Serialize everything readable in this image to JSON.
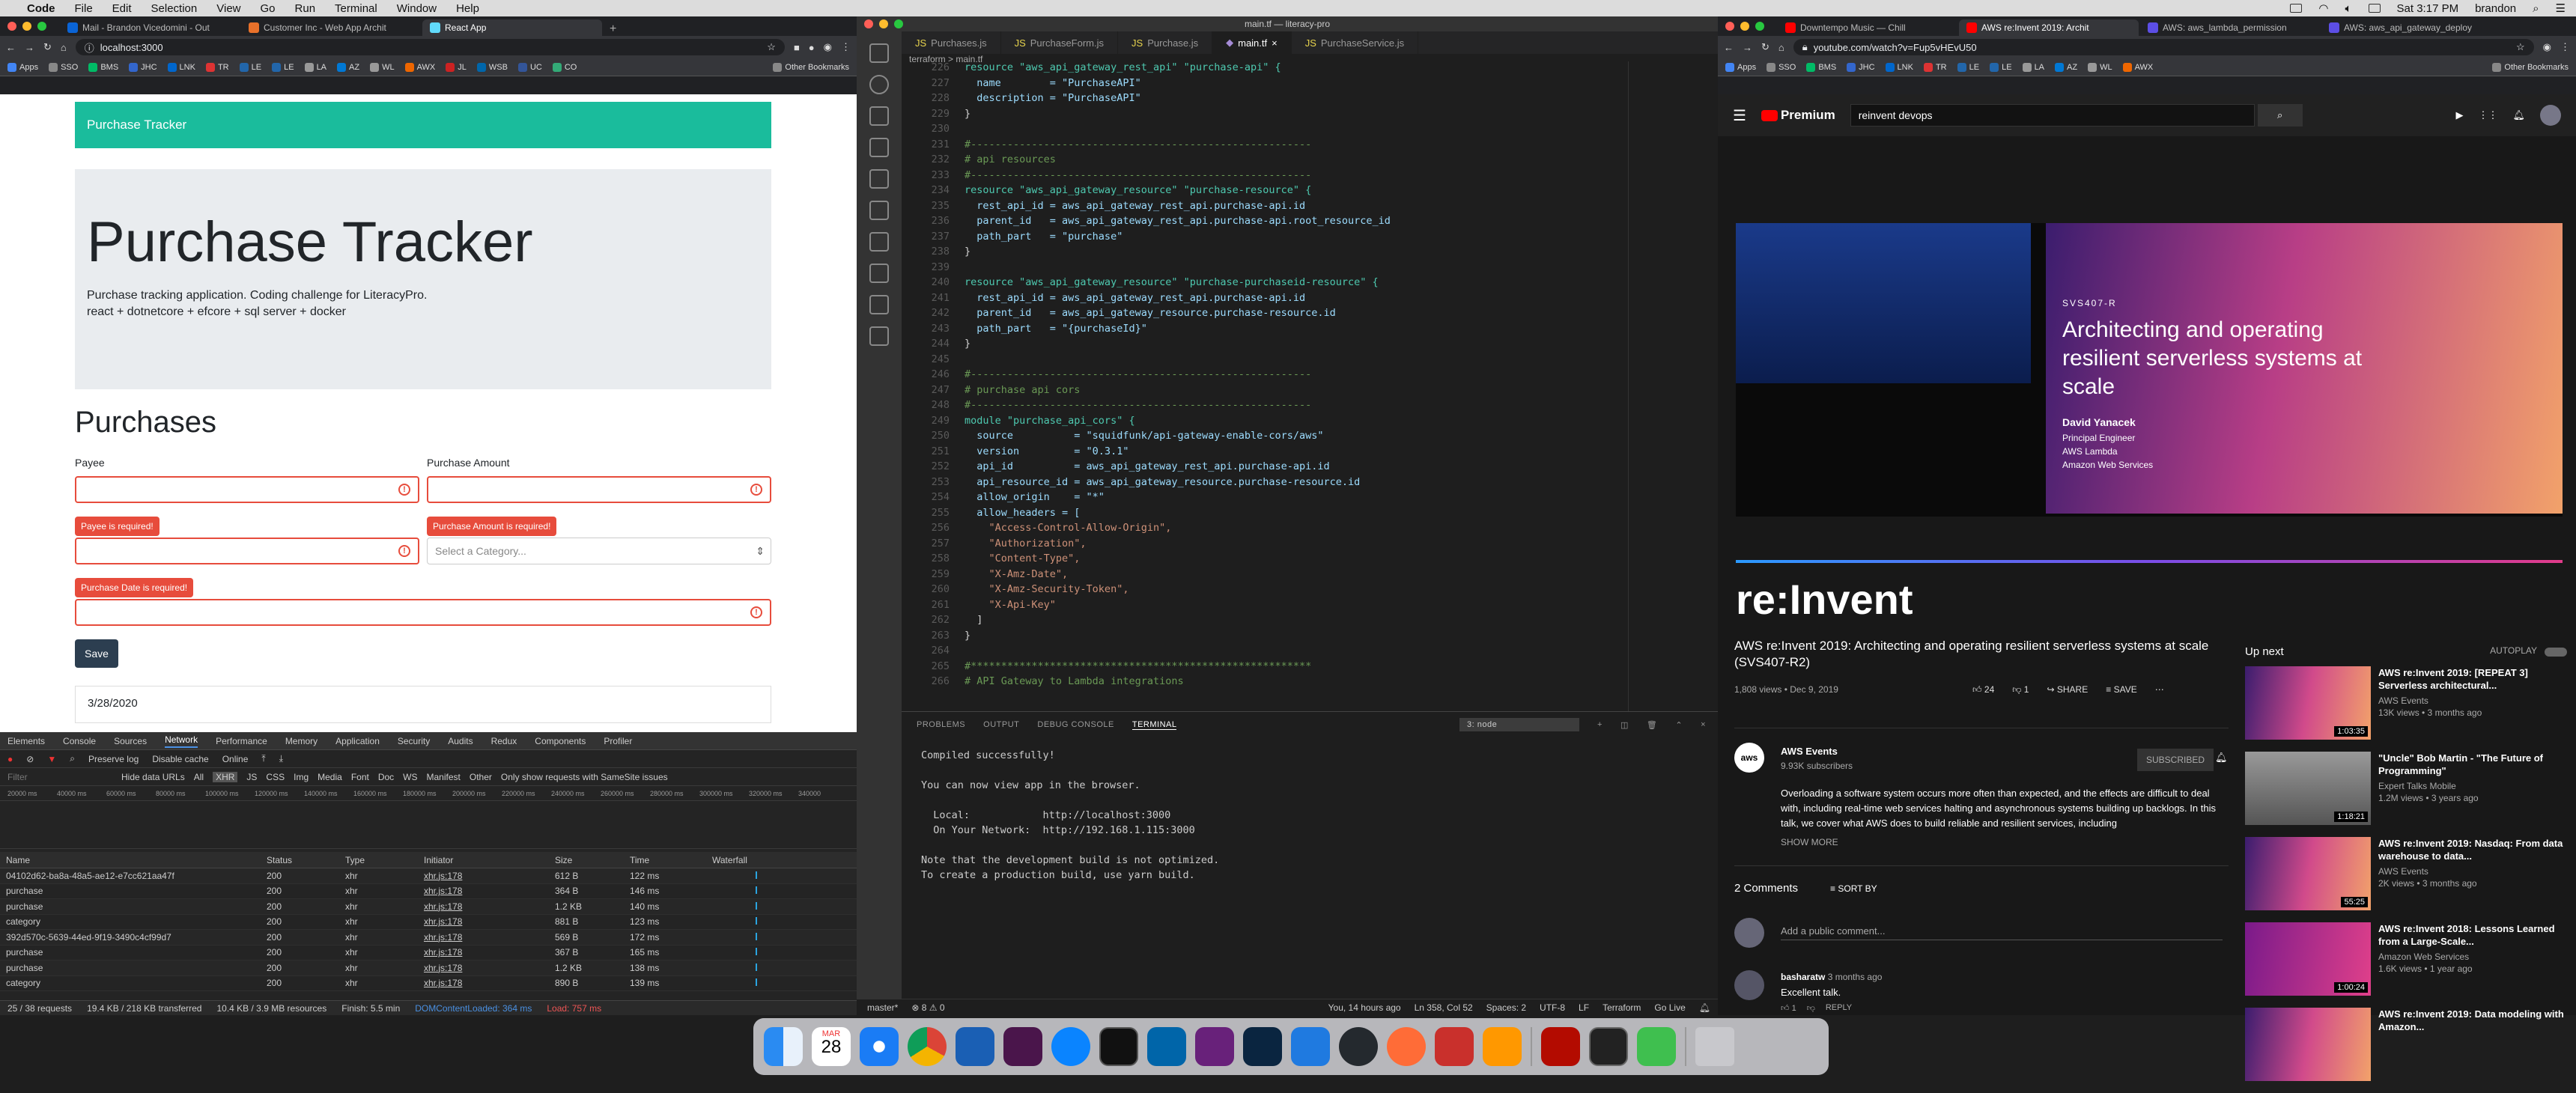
{
  "menubar": {
    "app": "Code",
    "items": [
      "File",
      "Edit",
      "Selection",
      "View",
      "Go",
      "Run",
      "Terminal",
      "Window",
      "Help"
    ],
    "clock": "Sat 3:17 PM",
    "user": "brandon"
  },
  "left_chrome": {
    "tabs": [
      "Mail - Brandon Vicedomini - Out",
      "Customer Inc - Web App Archit",
      "React App"
    ],
    "url": "localhost:3000",
    "bookmarks": [
      "Apps",
      "SSO",
      "BMS",
      "JHC",
      "LNK",
      "TR",
      "LE",
      "LE",
      "LA",
      "AZ",
      "WL",
      "AWX",
      "JL",
      "WSB",
      "UC",
      "CO"
    ],
    "other_bookmarks": "Other Bookmarks"
  },
  "purchase_app": {
    "brand": "Purchase Tracker",
    "heading": "Purchase Tracker",
    "lead1": "Purchase tracking application. Coding challenge for LiteracyPro.",
    "lead2": "react + dotnetcore + efcore + sql server + docker",
    "section": "Purchases",
    "payee_label": "Payee",
    "amount_label": "Purchase Amount",
    "payee_error": "Payee is required!",
    "amount_error": "Purchase Amount is required!",
    "date_error": "Purchase Date is required!",
    "category_placeholder": "Select a Category...",
    "save": "Save",
    "first_row_date": "3/28/2020"
  },
  "devtools": {
    "tabs": [
      "Elements",
      "Console",
      "Sources",
      "Network",
      "Performance",
      "Memory",
      "Application",
      "Security",
      "Audits",
      "Redux",
      "Components",
      "Profiler"
    ],
    "active_tab": "Network",
    "controls": [
      "Preserve log",
      "Disable cache",
      "Online"
    ],
    "filters": [
      "Hide data URLs",
      "All",
      "XHR",
      "JS",
      "CSS",
      "Img",
      "Media",
      "Font",
      "Doc",
      "WS",
      "Manifest",
      "Other",
      "Only show requests with SameSite issues"
    ],
    "timeline": [
      "20000 ms",
      "40000 ms",
      "60000 ms",
      "80000 ms",
      "100000 ms",
      "120000 ms",
      "140000 ms",
      "160000 ms",
      "180000 ms",
      "200000 ms",
      "220000 ms",
      "240000 ms",
      "260000 ms",
      "280000 ms",
      "300000 ms",
      "320000 ms",
      "340000"
    ],
    "columns": [
      "Name",
      "Status",
      "Type",
      "Initiator",
      "Size",
      "Time",
      "Waterfall"
    ],
    "rows": [
      {
        "name": "04102d62-ba8a-48a5-ae12-e7cc621aa47f",
        "status": "200",
        "type": "xhr",
        "init": "xhr.js:178",
        "size": "612 B",
        "time": "122 ms"
      },
      {
        "name": "purchase",
        "status": "200",
        "type": "xhr",
        "init": "xhr.js:178",
        "size": "364 B",
        "time": "146 ms"
      },
      {
        "name": "purchase",
        "status": "200",
        "type": "xhr",
        "init": "xhr.js:178",
        "size": "1.2 KB",
        "time": "140 ms"
      },
      {
        "name": "category",
        "status": "200",
        "type": "xhr",
        "init": "xhr.js:178",
        "size": "881 B",
        "time": "123 ms"
      },
      {
        "name": "392d570c-5639-44ed-9f19-3490c4cf99d7",
        "status": "200",
        "type": "xhr",
        "init": "xhr.js:178",
        "size": "569 B",
        "time": "172 ms"
      },
      {
        "name": "purchase",
        "status": "200",
        "type": "xhr",
        "init": "xhr.js:178",
        "size": "367 B",
        "time": "165 ms"
      },
      {
        "name": "purchase",
        "status": "200",
        "type": "xhr",
        "init": "xhr.js:178",
        "size": "1.2 KB",
        "time": "138 ms"
      },
      {
        "name": "category",
        "status": "200",
        "type": "xhr",
        "init": "xhr.js:178",
        "size": "890 B",
        "time": "139 ms"
      }
    ],
    "footer": [
      "25 / 38 requests",
      "19.4 KB / 218 KB transferred",
      "10.4 KB / 3.9 MB resources",
      "Finish: 5.5 min",
      "DOMContentLoaded: 364 ms",
      "Load: 757 ms"
    ]
  },
  "vscode": {
    "title": "main.tf — literacy-pro",
    "tabs": [
      "Purchases.js",
      "PurchaseForm.js",
      "Purchase.js",
      "main.tf",
      "PurchaseService.js"
    ],
    "active_tab": "main.tf",
    "breadcrumb": "terraform > main.tf",
    "lines": [
      [
        "226",
        "resource \"aws_api_gateway_rest_api\" \"purchase-api\" {"
      ],
      [
        "227",
        "  name        = \"PurchaseAPI\""
      ],
      [
        "228",
        "  description = \"PurchaseAPI\""
      ],
      [
        "229",
        "}"
      ],
      [
        "230",
        ""
      ],
      [
        "231",
        "#--------------------------------------------------------"
      ],
      [
        "232",
        "# api resources"
      ],
      [
        "233",
        "#--------------------------------------------------------"
      ],
      [
        "234",
        "resource \"aws_api_gateway_resource\" \"purchase-resource\" {"
      ],
      [
        "235",
        "  rest_api_id = aws_api_gateway_rest_api.purchase-api.id"
      ],
      [
        "236",
        "  parent_id   = aws_api_gateway_rest_api.purchase-api.root_resource_id"
      ],
      [
        "237",
        "  path_part   = \"purchase\""
      ],
      [
        "238",
        "}"
      ],
      [
        "239",
        ""
      ],
      [
        "240",
        "resource \"aws_api_gateway_resource\" \"purchase-purchaseid-resource\" {"
      ],
      [
        "241",
        "  rest_api_id = aws_api_gateway_rest_api.purchase-api.id"
      ],
      [
        "242",
        "  parent_id   = aws_api_gateway_resource.purchase-resource.id"
      ],
      [
        "243",
        "  path_part   = \"{purchaseId}\""
      ],
      [
        "244",
        "}"
      ],
      [
        "245",
        ""
      ],
      [
        "246",
        "#--------------------------------------------------------"
      ],
      [
        "247",
        "# purchase api cors"
      ],
      [
        "248",
        "#--------------------------------------------------------"
      ],
      [
        "249",
        "module \"purchase_api_cors\" {"
      ],
      [
        "250",
        "  source          = \"squidfunk/api-gateway-enable-cors/aws\""
      ],
      [
        "251",
        "  version         = \"0.3.1\""
      ],
      [
        "252",
        "  api_id          = aws_api_gateway_rest_api.purchase-api.id"
      ],
      [
        "253",
        "  api_resource_id = aws_api_gateway_resource.purchase-resource.id"
      ],
      [
        "254",
        "  allow_origin    = \"*\""
      ],
      [
        "255",
        "  allow_headers = ["
      ],
      [
        "256",
        "    \"Access-Control-Allow-Origin\","
      ],
      [
        "257",
        "    \"Authorization\","
      ],
      [
        "258",
        "    \"Content-Type\","
      ],
      [
        "259",
        "    \"X-Amz-Date\","
      ],
      [
        "260",
        "    \"X-Amz-Security-Token\","
      ],
      [
        "261",
        "    \"X-Api-Key\""
      ],
      [
        "262",
        "  ]"
      ],
      [
        "263",
        "}"
      ],
      [
        "264",
        ""
      ],
      [
        "265",
        "#********************************************************"
      ],
      [
        "266",
        "# API Gateway to Lambda integrations"
      ]
    ],
    "panel_tabs": [
      "PROBLEMS",
      "OUTPUT",
      "DEBUG CONSOLE",
      "TERMINAL"
    ],
    "panel_active": "TERMINAL",
    "terminal_select": "3: node",
    "terminal": "Compiled successfully!\n\nYou can now view app in the browser.\n\n  Local:            http://localhost:3000\n  On Your Network:  http://192.168.1.115:3000\n\nNote that the development build is not optimized.\nTo create a production build, use yarn build.",
    "status": [
      "master*",
      "⊗ 8 ⚠ 0",
      "You, 14 hours ago",
      "Ln 358, Col 52",
      "Spaces: 2",
      "UTF-8",
      "LF",
      "Terraform",
      "Go Live"
    ]
  },
  "right_chrome": {
    "tabs": [
      "Downtempo Music — Chill",
      "AWS re:Invent 2019: Archit",
      "AWS: aws_lambda_permission",
      "AWS: aws_api_gateway_deploy"
    ],
    "url": "youtube.com/watch?v=Fup5vHEvU50",
    "search": "reinvent devops",
    "premium": "Premium",
    "slide_code": "SVS407-R",
    "slide_title": "Architecting and operating resilient serverless systems at scale",
    "speaker": "David Yanacek",
    "speaker_role1": "Principal Engineer",
    "speaker_role2": "AWS Lambda",
    "speaker_role3": "Amazon Web Services",
    "brand": "re:Invent",
    "video_title": "AWS re:Invent 2019: Architecting and operating resilient serverless systems at scale (SVS407-R2)",
    "views": "1,808 views • Dec 9, 2019",
    "likes": "24",
    "dislikes": "1",
    "share": "SHARE",
    "save": "SAVE",
    "channel": "AWS Events",
    "subs": "9.93K subscribers",
    "subscribed": "SUBSCRIBED",
    "description": "Overloading a software system occurs more often than expected, and the effects are difficult to deal with, including real-time web services halting and asynchronous systems building up backlogs. In this talk, we cover what AWS does to build reliable and resilient services, including",
    "show_more": "SHOW MORE",
    "comments_count": "2 Comments",
    "sort_by": "SORT BY",
    "add_comment": "Add a public comment...",
    "comment_author": "basharatw",
    "comment_time": "3 months ago",
    "comment_text": "Excellent talk.",
    "comment_likes": "1",
    "reply": "REPLY",
    "up_next": "Up next",
    "autoplay": "AUTOPLAY",
    "suggestions": [
      {
        "title": "AWS re:Invent 2019: [REPEAT 3] Serverless architectural...",
        "channel": "AWS Events",
        "meta": "13K views • 3 months ago",
        "dur": "1:03:35"
      },
      {
        "title": "\"Uncle\" Bob Martin - \"The Future of Programming\"",
        "channel": "Expert Talks Mobile",
        "meta": "1.2M views • 3 years ago",
        "dur": "1:18:21"
      },
      {
        "title": "AWS re:Invent 2019: Nasdaq: From data warehouse to data...",
        "channel": "AWS Events",
        "meta": "2K views • 3 months ago",
        "dur": "55:25"
      },
      {
        "title": "AWS re:Invent 2018: Lessons Learned from a Large-Scale...",
        "channel": "Amazon Web Services",
        "meta": "1.6K views • 1 year ago",
        "dur": "1:00:24"
      },
      {
        "title": "AWS re:Invent 2019: Data modeling with Amazon...",
        "channel": "",
        "meta": "",
        "dur": ""
      }
    ]
  },
  "dock": {
    "calendar_month": "MAR",
    "calendar_day": "28"
  },
  "colors": {
    "teal": "#1abc9c",
    "error": "#e74c3c",
    "navy": "#2c3e50",
    "vs_bg": "#1e1e1e",
    "yt_bg": "#181818"
  }
}
